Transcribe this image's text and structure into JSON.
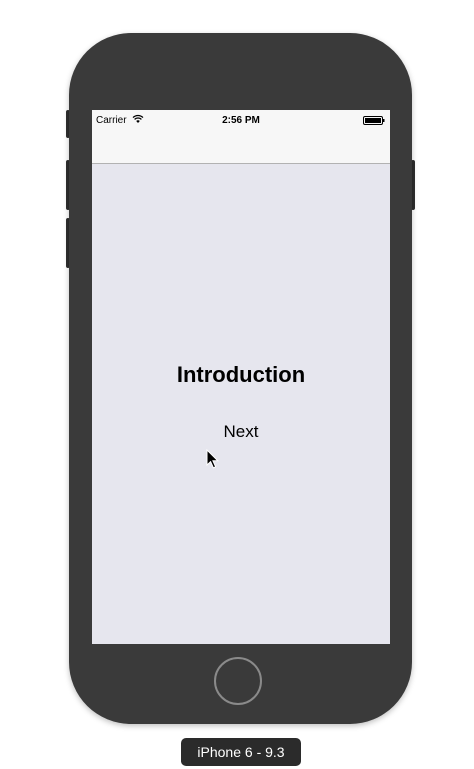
{
  "status_bar": {
    "carrier": "Carrier",
    "time": "2:56 PM",
    "wifi_icon": "wifi-icon",
    "battery_icon": "battery-full-icon"
  },
  "screen": {
    "background": "#e6e6ee",
    "title": "Introduction",
    "next_label": "Next"
  },
  "device": {
    "label": "iPhone 6 - 9.3",
    "body_color": "#3a3a3a"
  }
}
